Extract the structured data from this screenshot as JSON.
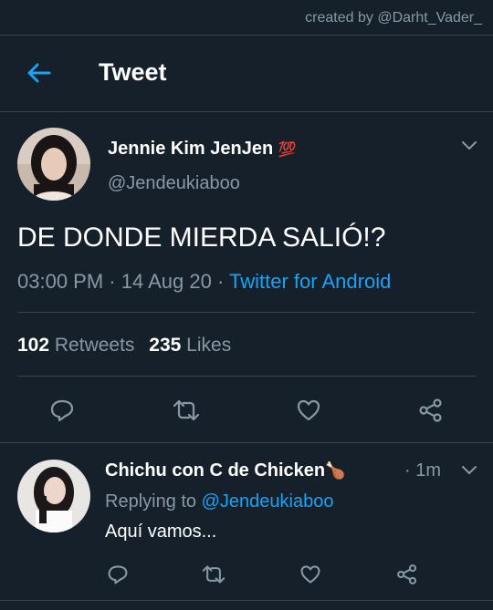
{
  "watermark": "created by @Darht_Vader_",
  "header": {
    "title": "Tweet",
    "back_icon": "arrow-left-icon"
  },
  "tweet": {
    "author_name": "Jennie Kim JenJen",
    "author_emoji": "💯",
    "handle": "@Jendeukiaboo",
    "text": "DE DONDE MIERDA SALIÓ!?",
    "time": "03:00 PM",
    "date": "14 Aug 20",
    "sep": "·",
    "source": "Twitter for Android",
    "retweets_count": "102",
    "retweets_label": "Retweets",
    "likes_count": "235",
    "likes_label": "Likes",
    "actions": [
      "reply-icon",
      "retweet-icon",
      "like-icon",
      "share-icon"
    ]
  },
  "reply": {
    "author_name": "Chichu con C de Chicken",
    "author_emoji": "🍗",
    "time": "· 1m",
    "replying_label": "Replying to",
    "replying_handle": "@Jendeukiaboo",
    "text": "Aquí vamos...",
    "actions": [
      "reply-icon",
      "retweet-icon",
      "like-icon",
      "share-icon"
    ]
  },
  "colors": {
    "background": "#15202b",
    "divider": "#38444d",
    "muted": "#8899a6",
    "accent": "#1da1f2"
  }
}
